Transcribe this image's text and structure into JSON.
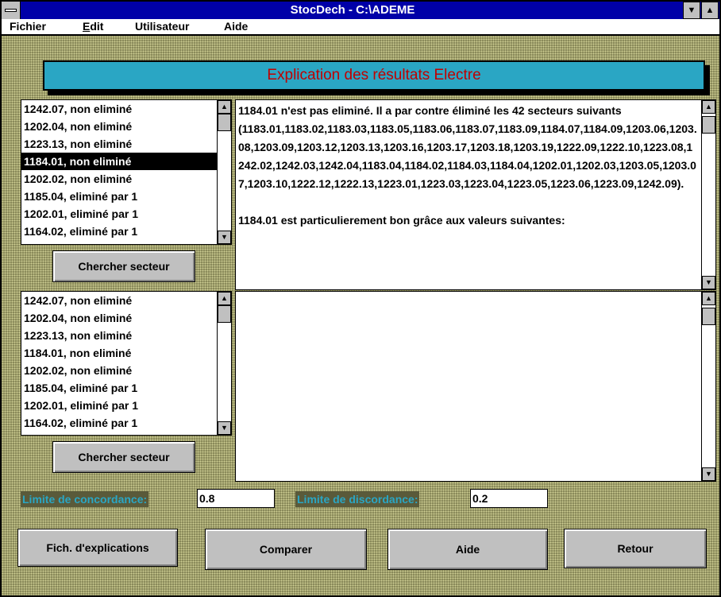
{
  "window": {
    "title": "StocDech - C:\\ADEME"
  },
  "menu": [
    {
      "label": "Fichier"
    },
    {
      "label": "Edit"
    },
    {
      "label": "Utilisateur"
    },
    {
      "label": "Aide"
    }
  ],
  "banner": "Explication des résultats Electre",
  "list1": {
    "items": [
      "1242.07, non eliminé",
      "1202.04, non eliminé",
      "1223.13, non eliminé",
      "1184.01, non eliminé",
      "1202.02, non eliminé",
      "1185.04, eliminé par 1",
      "1202.01, eliminé par 1",
      "1164.02, eliminé par 1"
    ],
    "selected_index": 3,
    "button": "Chercher secteur"
  },
  "list2": {
    "items": [
      "1242.07, non eliminé",
      "1202.04, non eliminé",
      "1223.13, non eliminé",
      "1184.01, non eliminé",
      "1202.02, non eliminé",
      "1185.04, eliminé par 1",
      "1202.01, eliminé par 1",
      "1164.02, eliminé par 1"
    ],
    "button": "Chercher secteur"
  },
  "explanation": {
    "line1": "1184.01 n'est pas eliminé. Il a par contre éliminé les 42 secteurs suivants",
    "line2": "(1183.01,1183.02,1183.03,1183.05,1183.06,1183.07,1183.09,1184.07,1184.09,1203.06,1203.08,1203.09,1203.12,1203.13,1203.16,1203.17,1203.18,1203.19,1222.09,1222.10,1223.08,1242.02,1242.03,1242.04,1183.04,1184.02,1184.03,1184.04,1202.01,1202.03,1203.05,1203.07,1203.10,1222.12,1222.13,1223.01,1223.03,1223.04,1223.05,1223.06,1223.09,1242.09).",
    "line3": "1184.01 est particulierement bon grâce aux valeurs suivantes:"
  },
  "second_text": "",
  "limits": {
    "concordance_label": "Limite de concordance:",
    "concordance_value": "0.8",
    "discordance_label": "Limite de discordance:",
    "discordance_value": "0.2"
  },
  "buttons": {
    "explications": "Fich. d'explications",
    "comparer": "Comparer",
    "aide": "Aide",
    "retour": "Retour"
  },
  "icons": {
    "system_menu": "system-menu-icon",
    "minimize": "down-arrow-icon",
    "maximize": "up-arrow-icon",
    "scroll_up": "up-arrow-icon",
    "scroll_down": "down-arrow-icon"
  }
}
